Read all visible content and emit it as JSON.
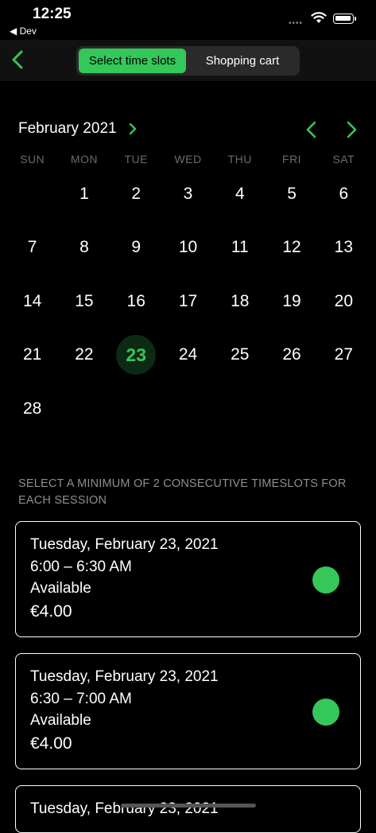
{
  "status_bar": {
    "time": "12:25",
    "back_app": "◀ Dev"
  },
  "nav": {
    "segments": [
      "Select time slots",
      "Shopping cart"
    ]
  },
  "calendar": {
    "month_title": "February 2021",
    "weekdays": [
      "SUN",
      "MON",
      "TUE",
      "WED",
      "THU",
      "FRI",
      "SAT"
    ],
    "leading_blanks": 1,
    "days": [
      "1",
      "2",
      "3",
      "4",
      "5",
      "6",
      "7",
      "8",
      "9",
      "10",
      "11",
      "12",
      "13",
      "14",
      "15",
      "16",
      "17",
      "18",
      "19",
      "20",
      "21",
      "22",
      "23",
      "24",
      "25",
      "26",
      "27",
      "28"
    ],
    "selected_day": "23"
  },
  "hint": "SELECT A MINIMUM OF 2 CONSECUTIVE TIMESLOTS FOR EACH SESSION",
  "slots": [
    {
      "date": "Tuesday, February 23, 2021",
      "time": "6:00 – 6:30 AM",
      "status": "Available",
      "price": "€4.00"
    },
    {
      "date": "Tuesday, February 23, 2021",
      "time": "6:30 – 7:00 AM",
      "status": "Available",
      "price": "€4.00"
    },
    {
      "date": "Tuesday, February 23, 2021"
    }
  ],
  "colors": {
    "accent": "#34c759",
    "background": "#000000"
  }
}
